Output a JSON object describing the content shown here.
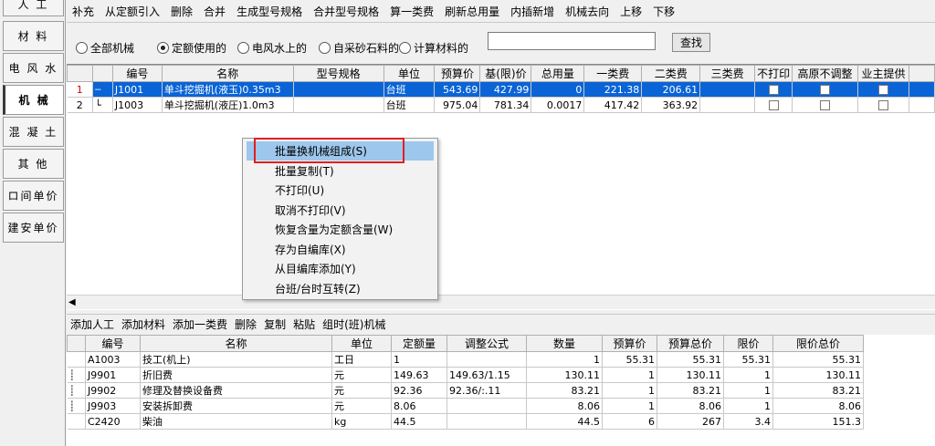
{
  "left_tabs": [
    "人  工",
    "材  料",
    "电 风 水",
    "机  械",
    "混 凝 土",
    "其  他",
    "ロ间单价",
    "建安单价"
  ],
  "toolbar": [
    "补充",
    "从定额引入",
    "删除",
    "合并",
    "生成型号规格",
    "合并型号规格",
    "算一类费",
    "刷新总用量",
    "内插新增",
    "机械去向",
    "上移",
    "下移"
  ],
  "filters": {
    "options": [
      "全部机械",
      "定额使用的",
      "电风水上的",
      "自采砂石料的",
      "计算材料的"
    ],
    "selected": "定额使用的",
    "search_value": "",
    "find_label": "查找"
  },
  "upper_table": {
    "headers": [
      "编号",
      "名称",
      "型号规格",
      "单位",
      "预算价",
      "基(限)价",
      "总用量",
      "一类费",
      "二类费",
      "三类费",
      "不打印",
      "高原不调整",
      "业主提供"
    ],
    "rows": [
      {
        "rownum": "1",
        "code": "J1001",
        "name": "单斗挖掘机(液玉)0.35m3",
        "spec": "",
        "unit": "台班",
        "budget": "543.69",
        "base": "427.99",
        "total": "0",
        "fee1": "221.38",
        "fee2": "206.61",
        "fee3": ""
      },
      {
        "rownum": "2",
        "code": "J1003",
        "name": "单斗挖掘机(液圧)1.0m3",
        "spec": "",
        "unit": "台班",
        "budget": "975.04",
        "base": "781.34",
        "total": "0.0017",
        "fee1": "417.42",
        "fee2": "363.92",
        "fee3": ""
      }
    ]
  },
  "context_menu": {
    "items": [
      "批量换机械组成(S)",
      "批量复制(T)",
      "不打印(U)",
      "取消不打印(V)",
      "恢复含量为定额含量(W)",
      "存为自编库(X)",
      "从目编库添加(Y)",
      "台班/台时互转(Z)"
    ],
    "highlighted": "批量换机械组成(S)"
  },
  "toolbar2": [
    "添加人工",
    "添加材料",
    "添加一类费",
    "删除",
    "复制",
    "粘贴",
    "组时(班)机械"
  ],
  "lower_table": {
    "headers": [
      "编号",
      "名称",
      "单位",
      "定额量",
      "调整公式",
      "数量",
      "预算价",
      "预算总价",
      "限价",
      "限价总价"
    ],
    "rows": [
      {
        "code": "A1003",
        "name": "技工(机上)",
        "unit": "工日",
        "quota": "1",
        "formula": "",
        "qty": "1",
        "price": "55.31",
        "total": "55.31",
        "limit": "55.31",
        "limit_total": "55.31"
      },
      {
        "code": "J9901",
        "name": "折旧费",
        "unit": "元",
        "quota": "149.63",
        "formula": "149.63/1.15",
        "qty": "130.11",
        "price": "1",
        "total": "130.11",
        "limit": "1",
        "limit_total": "130.11"
      },
      {
        "code": "J9902",
        "name": "修理及替换设备费",
        "unit": "元",
        "quota": "92.36",
        "formula": "92.36/:.11",
        "qty": "83.21",
        "price": "1",
        "total": "83.21",
        "limit": "1",
        "limit_total": "83.21"
      },
      {
        "code": "J9903",
        "name": "安装拆卸费",
        "unit": "元",
        "quota": "8.06",
        "formula": "",
        "qty": "8.06",
        "price": "1",
        "total": "8.06",
        "limit": "1",
        "limit_total": "8.06"
      },
      {
        "code": "C2420",
        "name": "柴油",
        "unit": "kg",
        "quota": "44.5",
        "formula": "",
        "qty": "44.5",
        "price": "6",
        "total": "267",
        "limit": "3.4",
        "limit_total": "151.3"
      }
    ]
  }
}
